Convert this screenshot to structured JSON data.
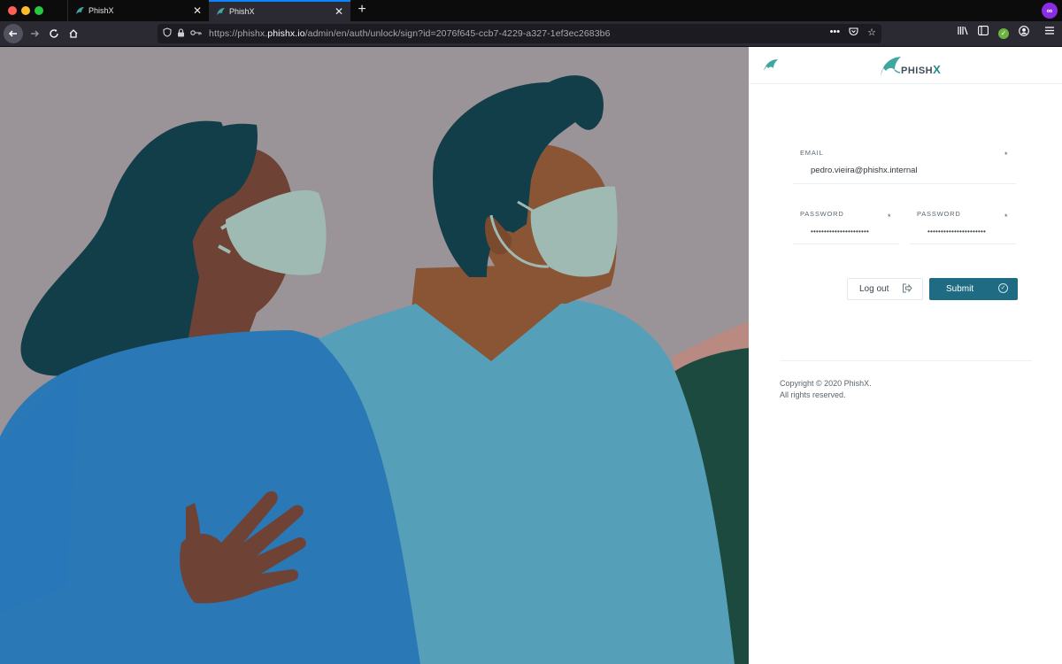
{
  "browser": {
    "tabs": [
      {
        "title": "PhishX",
        "close": "✕",
        "active": false
      },
      {
        "title": "PhishX",
        "close": "✕",
        "active": true
      }
    ],
    "new_tab": "+",
    "url": {
      "prefix": "https://phishx.",
      "host": "phishx.io",
      "path": "/admin/en/auth/unlock/sign?id=2076f645-ccb7-4229-a327-1ef3ec2683b6"
    },
    "toolbar_icons": [
      "back-icon",
      "forward-icon",
      "reload-icon",
      "home-icon",
      "tracking-shield-icon",
      "lock-icon",
      "key-icon",
      "more-icon",
      "pocket-icon",
      "bookmark-star-icon",
      "library-icon",
      "sidebar-icon",
      "extension-check-icon",
      "account-icon",
      "menu-icon"
    ]
  },
  "login": {
    "brand_name": "PHISH",
    "brand_x": "X",
    "email": {
      "label": "EMAIL",
      "required": "*",
      "value": "pedro.vieira@phishx.internal"
    },
    "password": {
      "label": "PASSWORD",
      "required": "*",
      "value": "••••••••••••••••••••••"
    },
    "password_confirm": {
      "label": "PASSWORD",
      "required": "*",
      "value": "••••••••••••••••••••••"
    },
    "logout_label": "Log out",
    "submit_label": "Submit",
    "copyright_line1": "Copyright © 2020 PhishX.",
    "copyright_line2": "All rights reserved."
  },
  "colors": {
    "accent": "#1f6b84",
    "brand_teal": "#1f8c87",
    "illustration_bg": "#9a9397"
  }
}
